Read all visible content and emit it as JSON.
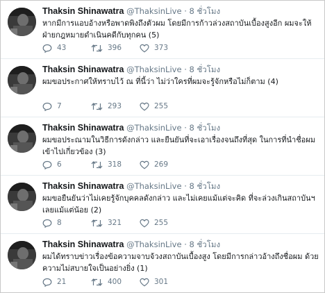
{
  "tweets": [
    {
      "name": "Thaksin Shinawatra",
      "handle": "@ThaksinLive",
      "separator": "·",
      "time": "8 ชั่วโมง",
      "text": "หากมีการแอบอ้างหรือพาดพิงถึงตัวผม โดยมีการก้าวล่วงสถาบันเบื้องสูงอีก ผมจะให้ฝ่ายกฎหมายดำเนินคดีกับทุกคน (5)",
      "replies": "43",
      "retweets": "396",
      "likes": "373"
    },
    {
      "name": "Thaksin Shinawatra",
      "handle": "@ThaksinLive",
      "separator": "·",
      "time": "8 ชั่วโมง",
      "text": "ผมขอประกาศให้ทราบไว้ ณ ที่นี้ว่า ไม่ว่าใครที่ผมจะรู้จักหรือไม่ก็ตาม (4)",
      "replies": "7",
      "retweets": "293",
      "likes": "255"
    },
    {
      "name": "Thaksin Shinawatra",
      "handle": "@ThaksinLive",
      "separator": "·",
      "time": "8 ชั่วโมง",
      "text": "ผมขอประณามในวิธีการดังกล่าว และยืนยันที่จะเอาเรื่องจนถึงที่สุด ในการที่นำชื่อผมเข้าไปเกี่ยวข้อง (3)",
      "replies": "6",
      "retweets": "318",
      "likes": "269"
    },
    {
      "name": "Thaksin Shinawatra",
      "handle": "@ThaksinLive",
      "separator": "·",
      "time": "8 ชั่วโมง",
      "text": "ผมขอยืนยันว่าไม่เคยรู้จักบุคคลดังกล่าว และไม่เคยแม้แต่จะคิด ที่จะล่วงเกินสถาบันฯ เลยแม้แต่น้อย (2)",
      "replies": "8",
      "retweets": "321",
      "likes": "255"
    },
    {
      "name": "Thaksin Shinawatra",
      "handle": "@ThaksinLive",
      "separator": "·",
      "time": "8 ชั่วโมง",
      "text": "ผมได้ทราบข่าวเรื่องข้อความจาบจ้วงสถาบันเบื้องสูง โดยมีการกล่าวอ้างถึงชื่อผม ด้วยความไม่สบายใจเป็นอย่างยิ่ง (1)",
      "replies": "21",
      "retweets": "400",
      "likes": "301"
    }
  ],
  "icons": {
    "reply": "reply-icon",
    "retweet": "retweet-icon",
    "like": "heart-icon"
  },
  "colors": {
    "text": "#14171a",
    "muted": "#657786",
    "divider": "#e6ecf0"
  }
}
